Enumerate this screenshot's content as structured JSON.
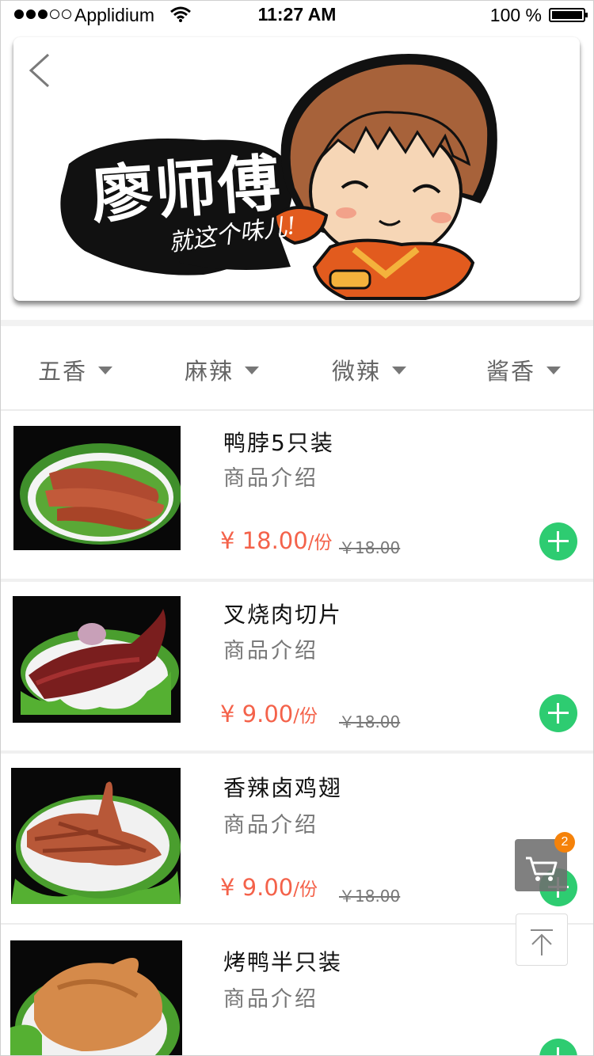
{
  "status_bar": {
    "carrier": "Applidium",
    "time": "11:27 AM",
    "battery": "100 %"
  },
  "banner": {
    "brand": "廖师傅",
    "slogan": "就这个味儿!"
  },
  "filters": [
    {
      "label": "五香"
    },
    {
      "label": "麻辣"
    },
    {
      "label": "微辣"
    },
    {
      "label": "酱香"
    }
  ],
  "products": [
    {
      "name": "鸭脖5只装",
      "desc": "商品介绍",
      "price": "¥ 18.00",
      "unit": "/份",
      "old_price": "￥18.00"
    },
    {
      "name": "叉烧肉切片",
      "desc": "商品介绍",
      "price": "¥ 9.00",
      "unit": "/份",
      "old_price": "￥18.00"
    },
    {
      "name": "香辣卤鸡翅",
      "desc": "商品介绍",
      "price": "¥ 9.00",
      "unit": "/份",
      "old_price": "￥18.00"
    },
    {
      "name": "烤鸭半只装",
      "desc": "商品介绍",
      "price": "",
      "unit": "",
      "old_price": ""
    }
  ],
  "cart": {
    "badge": "2"
  },
  "colors": {
    "accent_green": "#2ecc71",
    "price_red": "#f4624a",
    "badge_orange": "#f5820a"
  }
}
